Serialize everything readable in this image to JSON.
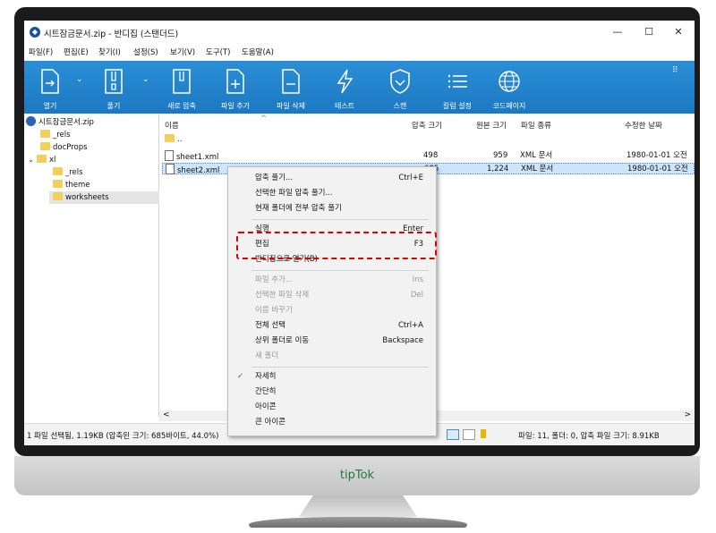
{
  "window": {
    "title": "시트잠금문서.zip - 반디집 (스탠더드)",
    "minimize": "—",
    "maximize": "☐",
    "close": "✕"
  },
  "menu": [
    "파일(F)",
    "편집(E)",
    "찾기(I)",
    "설정(S)",
    "보기(V)",
    "도구(T)",
    "도움말(A)"
  ],
  "toolbar": {
    "open": "열기",
    "extract": "풀기",
    "new_archive": "새로 압축",
    "add_file": "파일 추가",
    "delete_file": "파일 삭제",
    "test": "테스트",
    "scan": "스캔",
    "column_settings": "칼럼 설정",
    "codepage": "코드페이지",
    "dd": "⌄",
    "grid": "⠿"
  },
  "tree": {
    "root": "시트잠금문서.zip",
    "items": [
      "_rels",
      "docProps",
      "xl",
      "_rels",
      "theme",
      "worksheets"
    ],
    "expand_xl": "⌄"
  },
  "columns": {
    "name": "이름",
    "packed": "압축 크기",
    "original": "원본 크기",
    "type": "파일 종류",
    "modified": "수정한 날짜",
    "sort": "^"
  },
  "rows": [
    {
      "name": "..",
      "packed": "",
      "original": "",
      "type": "",
      "modified": ""
    },
    {
      "name": "sheet1.xml",
      "packed": "498",
      "original": "959",
      "type": "XML 문서",
      "modified": "1980-01-01 오전"
    },
    {
      "name": "sheet2.xml",
      "packed": "685",
      "original": "1,224",
      "type": "XML 문서",
      "modified": "1980-01-01 오전"
    }
  ],
  "status": {
    "left": "1 파일 선택됨, 1.19KB (압축된 크기: 685바이트, 44.0%)",
    "right": "파일: 11, 폴더: 0, 압축 파일 크기: 8.91KB"
  },
  "scroll": {
    "left": "<",
    "right": ">"
  },
  "context_menu": {
    "extract": "압축 풀기...",
    "extract_key": "Ctrl+E",
    "extract_selected": "선택한 파일 압축 풀기...",
    "extract_here": "현재 폴더에 전부 압축 풀기",
    "run": "실행",
    "run_key": "Enter",
    "edit": "편집",
    "edit_key": "F3",
    "open_with": "반디집으로 열기(B)",
    "add_file": "파일 추가...",
    "add_key": "Ins",
    "delete_selected": "선택한 파일 삭제",
    "delete_key": "Del",
    "rename": "이름 바꾸기",
    "select_all": "전체 선택",
    "select_all_key": "Ctrl+A",
    "go_up": "상위 폴더로 이동",
    "go_up_key": "Backspace",
    "new_folder": "새 폴더",
    "details": "자세히",
    "check": "✓",
    "simple": "간단히",
    "icons": "아이콘",
    "large_icons": "큰 아이콘"
  },
  "brand": "tipTok",
  "colors": {
    "toolbar": "#1c78c2",
    "highlight": "#e10000",
    "selection": "#cde5fb"
  }
}
